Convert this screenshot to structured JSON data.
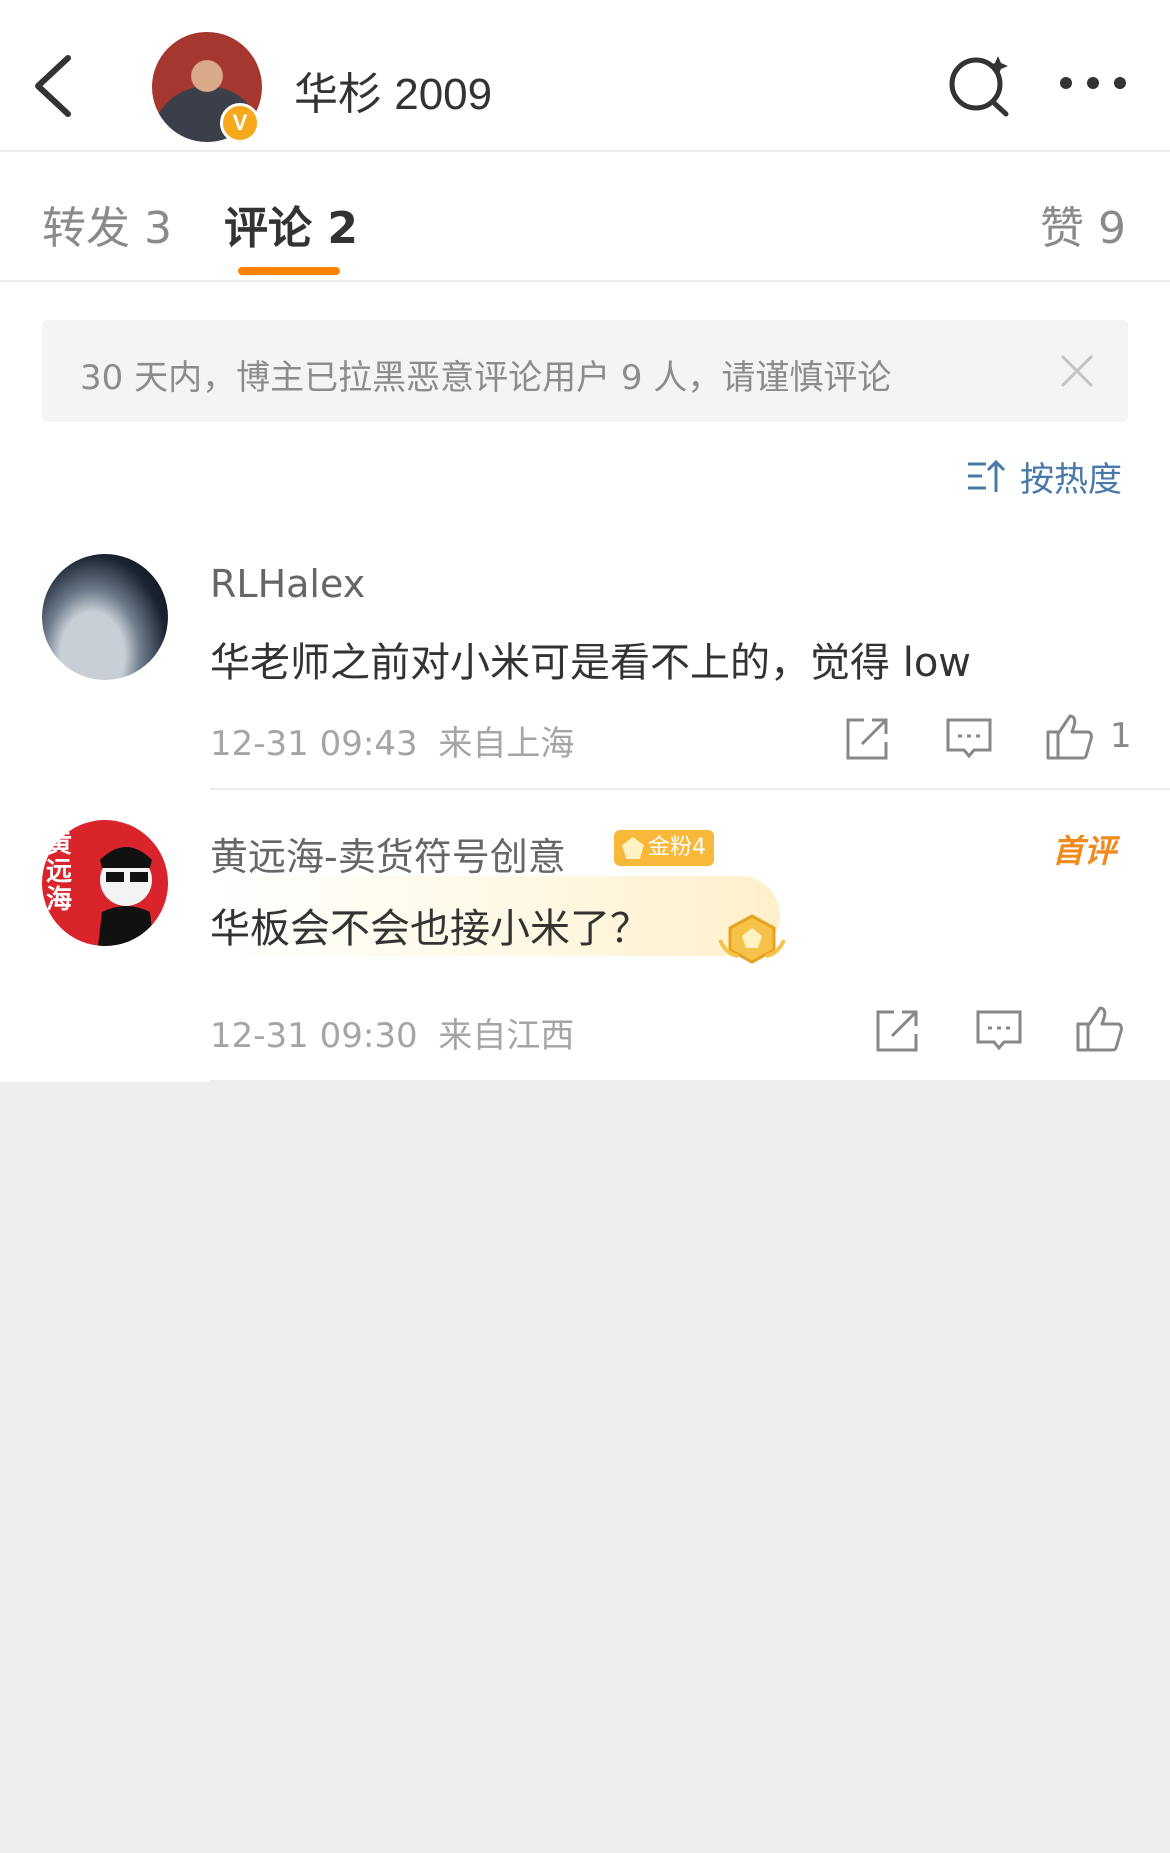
{
  "header": {
    "title": "华杉 2009",
    "verified_badge": "V"
  },
  "tabs": [
    {
      "label": "转发 3"
    },
    {
      "label": "评论 2"
    },
    {
      "label": "赞 9"
    }
  ],
  "notice": {
    "text": "30 天内，博主已拉黑恶意评论用户 9 人，请谨慎评论"
  },
  "sort": {
    "label": "按热度"
  },
  "comments": [
    {
      "name": "RLHalex",
      "text": "华老师之前对小米可是看不上的，觉得 low",
      "time": "12-31 09:43",
      "location": "来自上海",
      "likes": "1"
    },
    {
      "name": "黄远海-卖货符号创意",
      "fan_badge": "金粉4",
      "first_badge": "首评",
      "text": "华板会不会也接小米了？",
      "time": "12-31 09:30",
      "location": "来自江西",
      "avatar_text": "黄远海"
    }
  ],
  "colors": {
    "accent": "#ff8200",
    "link": "#4a78a8",
    "badge_gold": "#f8b83a",
    "background": "#eeeeee"
  },
  "icons": [
    "back-arrow-icon",
    "search-icon",
    "more-icon",
    "close-icon",
    "sort-icon",
    "share-icon",
    "comment-icon",
    "like-icon"
  ]
}
